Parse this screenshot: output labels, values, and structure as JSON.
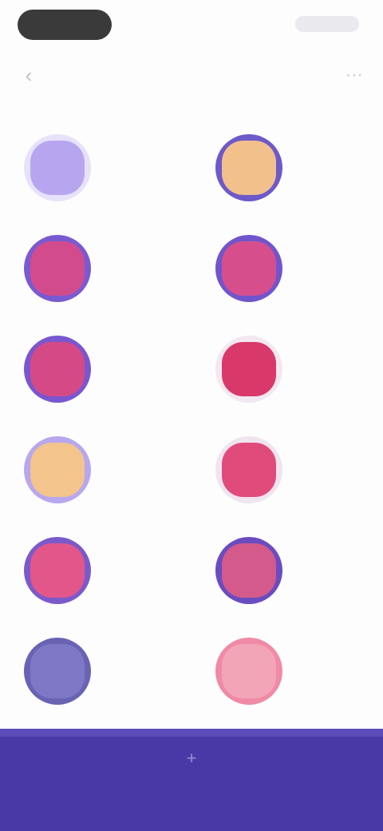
{
  "status_bar": {
    "left_pill": "",
    "right_indicators": ""
  },
  "header": {
    "title": "",
    "back_icon": "chevron-left-icon",
    "action_icon": "more-icon"
  },
  "items": [
    {
      "label": "",
      "icon": "avatar-icon",
      "outer": "#e7e1fb",
      "inner": "#b7a6ef"
    },
    {
      "label": "",
      "icon": "avatar-icon",
      "outer": "#6e59c9",
      "inner": "#f2c08b"
    },
    {
      "label": "",
      "icon": "avatar-icon",
      "outer": "#7a5ad1",
      "inner": "#d24c8d"
    },
    {
      "label": "",
      "icon": "avatar-icon",
      "outer": "#7155cc",
      "inner": "#d64f8c"
    },
    {
      "label": "",
      "icon": "avatar-icon",
      "outer": "#7a56cf",
      "inner": "#d54a86"
    },
    {
      "label": "",
      "icon": "avatar-icon",
      "outer": "#f3e8f0",
      "inner": "#d9386a"
    },
    {
      "label": "",
      "icon": "avatar-icon",
      "outer": "#b7a7ee",
      "inner": "#f3c48b"
    },
    {
      "label": "",
      "icon": "avatar-icon",
      "outer": "#f0e4ef",
      "inner": "#e04b7b"
    },
    {
      "label": "",
      "icon": "avatar-icon",
      "outer": "#7a5acb",
      "inner": "#e2568a"
    },
    {
      "label": "",
      "icon": "avatar-icon",
      "outer": "#6a4cc0",
      "inner": "#d45a8c"
    },
    {
      "label": "",
      "icon": "avatar-icon",
      "outer": "#6a62b3",
      "inner": "#7f78c6"
    },
    {
      "label": "",
      "icon": "avatar-icon",
      "outer": "#f08aa6",
      "inner": "#f3a5b8"
    }
  ],
  "bottom_bar": {
    "label": "",
    "icon": "add-icon"
  },
  "colors": {
    "primary": "#4839a6",
    "background": "#fdfdfe"
  }
}
